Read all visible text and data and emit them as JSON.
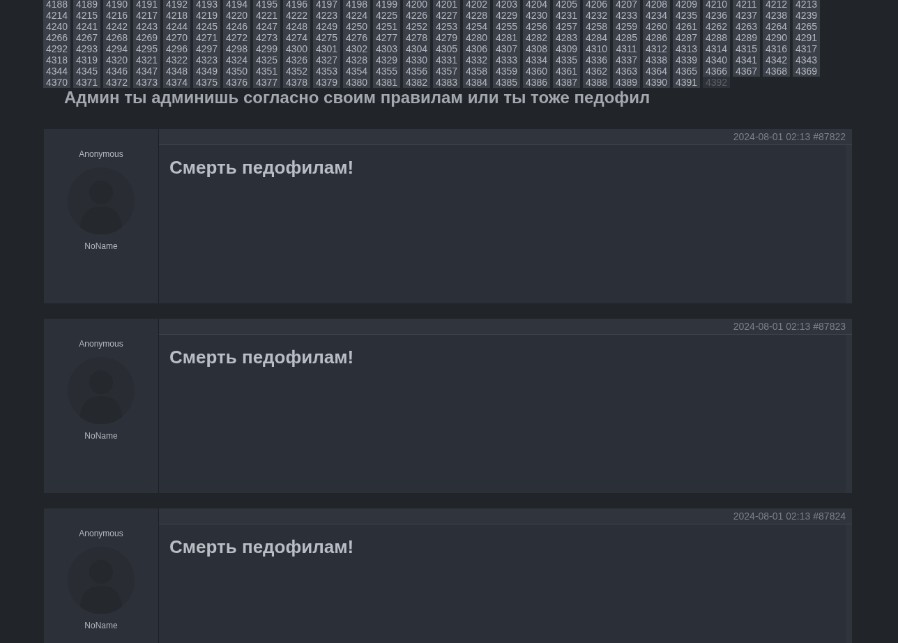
{
  "pagination": {
    "pages": [
      {
        "label": "4188",
        "selected": false
      },
      {
        "label": "4189",
        "selected": false
      },
      {
        "label": "4190",
        "selected": false
      },
      {
        "label": "4191",
        "selected": false
      },
      {
        "label": "4192",
        "selected": false
      },
      {
        "label": "4193",
        "selected": false
      },
      {
        "label": "4194",
        "selected": false
      },
      {
        "label": "4195",
        "selected": false
      },
      {
        "label": "4196",
        "selected": false
      },
      {
        "label": "4197",
        "selected": false
      },
      {
        "label": "4198",
        "selected": false
      },
      {
        "label": "4199",
        "selected": false
      },
      {
        "label": "4200",
        "selected": false
      },
      {
        "label": "4201",
        "selected": false
      },
      {
        "label": "4202",
        "selected": false
      },
      {
        "label": "4203",
        "selected": false
      },
      {
        "label": "4204",
        "selected": false
      },
      {
        "label": "4205",
        "selected": false
      },
      {
        "label": "4206",
        "selected": false
      },
      {
        "label": "4207",
        "selected": false
      },
      {
        "label": "4208",
        "selected": false
      },
      {
        "label": "4209",
        "selected": false
      },
      {
        "label": "4210",
        "selected": false
      },
      {
        "label": "4211",
        "selected": false
      },
      {
        "label": "4212",
        "selected": false
      },
      {
        "label": "4213",
        "selected": false
      },
      {
        "label": "4214",
        "selected": false
      },
      {
        "label": "4215",
        "selected": false
      },
      {
        "label": "4216",
        "selected": false
      },
      {
        "label": "4217",
        "selected": false
      },
      {
        "label": "4218",
        "selected": false
      },
      {
        "label": "4219",
        "selected": false
      },
      {
        "label": "4220",
        "selected": false
      },
      {
        "label": "4221",
        "selected": false
      },
      {
        "label": "4222",
        "selected": false
      },
      {
        "label": "4223",
        "selected": false
      },
      {
        "label": "4224",
        "selected": false
      },
      {
        "label": "4225",
        "selected": false
      },
      {
        "label": "4226",
        "selected": false
      },
      {
        "label": "4227",
        "selected": false
      },
      {
        "label": "4228",
        "selected": false
      },
      {
        "label": "4229",
        "selected": false
      },
      {
        "label": "4230",
        "selected": false
      },
      {
        "label": "4231",
        "selected": false
      },
      {
        "label": "4232",
        "selected": false
      },
      {
        "label": "4233",
        "selected": false
      },
      {
        "label": "4234",
        "selected": false
      },
      {
        "label": "4235",
        "selected": false
      },
      {
        "label": "4236",
        "selected": false
      },
      {
        "label": "4237",
        "selected": false
      },
      {
        "label": "4238",
        "selected": false
      },
      {
        "label": "4239",
        "selected": false
      },
      {
        "label": "4240",
        "selected": false
      },
      {
        "label": "4241",
        "selected": false
      },
      {
        "label": "4242",
        "selected": false
      },
      {
        "label": "4243",
        "selected": false
      },
      {
        "label": "4244",
        "selected": false
      },
      {
        "label": "4245",
        "selected": false
      },
      {
        "label": "4246",
        "selected": false
      },
      {
        "label": "4247",
        "selected": false
      },
      {
        "label": "4248",
        "selected": false
      },
      {
        "label": "4249",
        "selected": false
      },
      {
        "label": "4250",
        "selected": false
      },
      {
        "label": "4251",
        "selected": false
      },
      {
        "label": "4252",
        "selected": false
      },
      {
        "label": "4253",
        "selected": false
      },
      {
        "label": "4254",
        "selected": false
      },
      {
        "label": "4255",
        "selected": false
      },
      {
        "label": "4256",
        "selected": false
      },
      {
        "label": "4257",
        "selected": false
      },
      {
        "label": "4258",
        "selected": false
      },
      {
        "label": "4259",
        "selected": false
      },
      {
        "label": "4260",
        "selected": false
      },
      {
        "label": "4261",
        "selected": false
      },
      {
        "label": "4262",
        "selected": false
      },
      {
        "label": "4263",
        "selected": false
      },
      {
        "label": "4264",
        "selected": false
      },
      {
        "label": "4265",
        "selected": false
      },
      {
        "label": "4266",
        "selected": false
      },
      {
        "label": "4267",
        "selected": false
      },
      {
        "label": "4268",
        "selected": false
      },
      {
        "label": "4269",
        "selected": false
      },
      {
        "label": "4270",
        "selected": false
      },
      {
        "label": "4271",
        "selected": false
      },
      {
        "label": "4272",
        "selected": false
      },
      {
        "label": "4273",
        "selected": false
      },
      {
        "label": "4274",
        "selected": false
      },
      {
        "label": "4275",
        "selected": false
      },
      {
        "label": "4276",
        "selected": false
      },
      {
        "label": "4277",
        "selected": false
      },
      {
        "label": "4278",
        "selected": false
      },
      {
        "label": "4279",
        "selected": false
      },
      {
        "label": "4280",
        "selected": false
      },
      {
        "label": "4281",
        "selected": false
      },
      {
        "label": "4282",
        "selected": false
      },
      {
        "label": "4283",
        "selected": false
      },
      {
        "label": "4284",
        "selected": false
      },
      {
        "label": "4285",
        "selected": false
      },
      {
        "label": "4286",
        "selected": false
      },
      {
        "label": "4287",
        "selected": false
      },
      {
        "label": "4288",
        "selected": false
      },
      {
        "label": "4289",
        "selected": false
      },
      {
        "label": "4290",
        "selected": false
      },
      {
        "label": "4291",
        "selected": false
      },
      {
        "label": "4292",
        "selected": false
      },
      {
        "label": "4293",
        "selected": false
      },
      {
        "label": "4294",
        "selected": false
      },
      {
        "label": "4295",
        "selected": false
      },
      {
        "label": "4296",
        "selected": false
      },
      {
        "label": "4297",
        "selected": false
      },
      {
        "label": "4298",
        "selected": false
      },
      {
        "label": "4299",
        "selected": false
      },
      {
        "label": "4300",
        "selected": false
      },
      {
        "label": "4301",
        "selected": false
      },
      {
        "label": "4302",
        "selected": false
      },
      {
        "label": "4303",
        "selected": false
      },
      {
        "label": "4304",
        "selected": false
      },
      {
        "label": "4305",
        "selected": false
      },
      {
        "label": "4306",
        "selected": false
      },
      {
        "label": "4307",
        "selected": false
      },
      {
        "label": "4308",
        "selected": false
      },
      {
        "label": "4309",
        "selected": false
      },
      {
        "label": "4310",
        "selected": false
      },
      {
        "label": "4311",
        "selected": false
      },
      {
        "label": "4312",
        "selected": false
      },
      {
        "label": "4313",
        "selected": false
      },
      {
        "label": "4314",
        "selected": false
      },
      {
        "label": "4315",
        "selected": false
      },
      {
        "label": "4316",
        "selected": false
      },
      {
        "label": "4317",
        "selected": false
      },
      {
        "label": "4318",
        "selected": false
      },
      {
        "label": "4319",
        "selected": false
      },
      {
        "label": "4320",
        "selected": false
      },
      {
        "label": "4321",
        "selected": false
      },
      {
        "label": "4322",
        "selected": false
      },
      {
        "label": "4323",
        "selected": false
      },
      {
        "label": "4324",
        "selected": false
      },
      {
        "label": "4325",
        "selected": false
      },
      {
        "label": "4326",
        "selected": false
      },
      {
        "label": "4327",
        "selected": false
      },
      {
        "label": "4328",
        "selected": false
      },
      {
        "label": "4329",
        "selected": false
      },
      {
        "label": "4330",
        "selected": false
      },
      {
        "label": "4331",
        "selected": false
      },
      {
        "label": "4332",
        "selected": false
      },
      {
        "label": "4333",
        "selected": false
      },
      {
        "label": "4334",
        "selected": false
      },
      {
        "label": "4335",
        "selected": false
      },
      {
        "label": "4336",
        "selected": false
      },
      {
        "label": "4337",
        "selected": false
      },
      {
        "label": "4338",
        "selected": false
      },
      {
        "label": "4339",
        "selected": false
      },
      {
        "label": "4340",
        "selected": false
      },
      {
        "label": "4341",
        "selected": false
      },
      {
        "label": "4342",
        "selected": false
      },
      {
        "label": "4343",
        "selected": false
      },
      {
        "label": "4344",
        "selected": false
      },
      {
        "label": "4345",
        "selected": false
      },
      {
        "label": "4346",
        "selected": false
      },
      {
        "label": "4347",
        "selected": false
      },
      {
        "label": "4348",
        "selected": false
      },
      {
        "label": "4349",
        "selected": false
      },
      {
        "label": "4350",
        "selected": false
      },
      {
        "label": "4351",
        "selected": false
      },
      {
        "label": "4352",
        "selected": false
      },
      {
        "label": "4353",
        "selected": false
      },
      {
        "label": "4354",
        "selected": false
      },
      {
        "label": "4355",
        "selected": false
      },
      {
        "label": "4356",
        "selected": false
      },
      {
        "label": "4357",
        "selected": false
      },
      {
        "label": "4358",
        "selected": false
      },
      {
        "label": "4359",
        "selected": false
      },
      {
        "label": "4360",
        "selected": false
      },
      {
        "label": "4361",
        "selected": false
      },
      {
        "label": "4362",
        "selected": false
      },
      {
        "label": "4363",
        "selected": false
      },
      {
        "label": "4364",
        "selected": false
      },
      {
        "label": "4365",
        "selected": false
      },
      {
        "label": "4366",
        "selected": false
      },
      {
        "label": "4367",
        "selected": false
      },
      {
        "label": "4368",
        "selected": false
      },
      {
        "label": "4369",
        "selected": false
      },
      {
        "label": "4370",
        "selected": false
      },
      {
        "label": "4371",
        "selected": false
      },
      {
        "label": "4372",
        "selected": false
      },
      {
        "label": "4373",
        "selected": false
      },
      {
        "label": "4374",
        "selected": false
      },
      {
        "label": "4375",
        "selected": false
      },
      {
        "label": "4376",
        "selected": false
      },
      {
        "label": "4377",
        "selected": false
      },
      {
        "label": "4378",
        "selected": false
      },
      {
        "label": "4379",
        "selected": false
      },
      {
        "label": "4380",
        "selected": false
      },
      {
        "label": "4381",
        "selected": false
      },
      {
        "label": "4382",
        "selected": false
      },
      {
        "label": "4383",
        "selected": false
      },
      {
        "label": "4384",
        "selected": false
      },
      {
        "label": "4385",
        "selected": false
      },
      {
        "label": "4386",
        "selected": false
      },
      {
        "label": "4387",
        "selected": false
      },
      {
        "label": "4388",
        "selected": false
      },
      {
        "label": "4389",
        "selected": false
      },
      {
        "label": "4390",
        "selected": false
      },
      {
        "label": "4391",
        "selected": false
      },
      {
        "label": "4392",
        "selected": true
      }
    ]
  },
  "thread": {
    "title": "Админ ты админишь согласно своим правилам или ты тоже педофил"
  },
  "posts": [
    {
      "author": "Anonymous",
      "name": "NoName",
      "date": "2024-08-01 02:13",
      "number": "#87822",
      "body": "Смерть педофилам!"
    },
    {
      "author": "Anonymous",
      "name": "NoName",
      "date": "2024-08-01 02:13",
      "number": "#87823",
      "body": "Смерть педофилам!"
    },
    {
      "author": "Anonymous",
      "name": "NoName",
      "date": "2024-08-01 02:13",
      "number": "#87824",
      "body": "Смерть педофилам!"
    }
  ]
}
